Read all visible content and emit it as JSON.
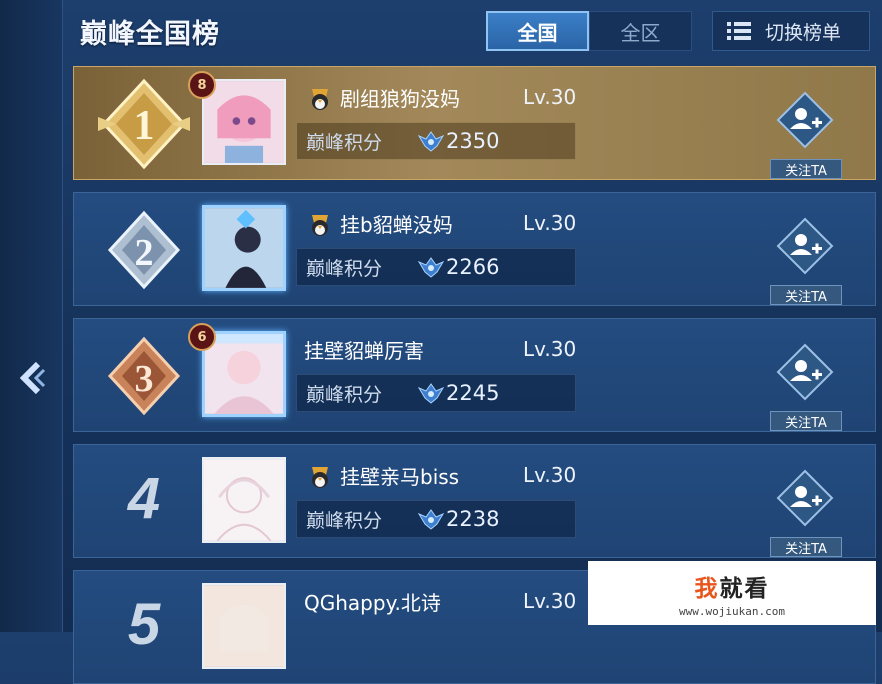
{
  "header": {
    "title": "巅峰全国榜",
    "tabs": [
      {
        "label": "全国",
        "active": true
      },
      {
        "label": "全区",
        "active": false
      }
    ],
    "switch_button_label": "切换榜单"
  },
  "rankings": [
    {
      "rank": "1",
      "avatar_level_badge": "8",
      "name": "剧组狼狗没妈",
      "level": "Lv.30",
      "score_label": "巅峰积分",
      "score": "2350",
      "follow_label": "关注TA"
    },
    {
      "rank": "2",
      "name": "挂b貂蝉没妈",
      "level": "Lv.30",
      "score_label": "巅峰积分",
      "score": "2266",
      "follow_label": "关注TA"
    },
    {
      "rank": "3",
      "avatar_level_badge": "6",
      "name": "挂壁貂蝉厉害",
      "level": "Lv.30",
      "score_label": "巅峰积分",
      "score": "2245",
      "follow_label": "关注TA"
    },
    {
      "rank": "4",
      "name": "挂壁亲马biss",
      "level": "Lv.30",
      "score_label": "巅峰积分",
      "score": "2238",
      "follow_label": "关注TA"
    },
    {
      "rank": "5",
      "name": "QGhappy.北诗",
      "level": "Lv.30"
    }
  ],
  "watermark": {
    "brand_highlight": "我",
    "brand_rest": "就看",
    "url": "www.wojiukan.com"
  },
  "colors": {
    "first_place_gold": "#a3895a",
    "row_blue": "#244c80",
    "active_tab": "#3b7fc7",
    "follow_label_bg": "#35587f"
  },
  "icons": [
    "back-arrow-icon",
    "list-icon",
    "gold-rank-icon",
    "silver-rank-icon",
    "bronze-rank-icon",
    "rank-penguin-icon",
    "peak-score-icon",
    "follow-user-icon"
  ]
}
